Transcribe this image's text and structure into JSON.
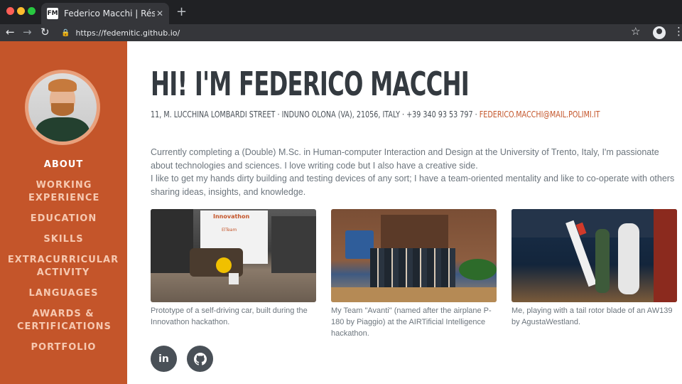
{
  "browser": {
    "tab_icon": "FM",
    "tab_title": "Federico Macchi | Résumé",
    "url": "https://fedemitic.github.io/"
  },
  "sidebar": {
    "items": [
      {
        "label": "ABOUT"
      },
      {
        "label": "WORKING EXPERIENCE"
      },
      {
        "label": "EDUCATION"
      },
      {
        "label": "SKILLS"
      },
      {
        "label": "EXTRACURRICULAR ACTIVITY"
      },
      {
        "label": "LANGUAGES"
      },
      {
        "label": "AWARDS & CERTIFICATIONS"
      },
      {
        "label": "PORTFOLIO"
      }
    ]
  },
  "header": {
    "name": "HI! I'M FEDERICO MACCHI",
    "contact": "11, M. LUCCHINA LOMBARDI STREET · INDUNO OLONA (VA), 21056, ITALY · +39 340 93 53 797 · ",
    "email": "FEDERICO.MACCHI@MAIL.POLIMI.IT"
  },
  "bio": [
    "Currently completing a (Double) M.Sc. in Human-computer Interaction and Design at the University of Trento, Italy, I'm passionate about technologies and sciences. I love writing code but I also have a creative side.",
    "I like to get my hands dirty building and testing devices of any sort; I have a team-oriented mentality and like to co-operate with others sharing ideas, insights, and knowledge."
  ],
  "gallery": [
    {
      "caption": "Prototype of a self-driving car, built during the Innovathon hackathon.",
      "sign_text": "Innovathon",
      "slide_text": "ElTeam"
    },
    {
      "caption": "My Team \"Avanti\" (named after the airplane P-180 by Piaggio) at the AIRTificial Intelligence hackathon."
    },
    {
      "caption": "Me, playing with a tail rotor blade of an AW139 by AgustaWestland."
    }
  ],
  "social": {
    "linkedin_label": "in"
  },
  "colors": {
    "accent": "#c4552a",
    "heading": "#343a40",
    "text": "#6c757d"
  }
}
